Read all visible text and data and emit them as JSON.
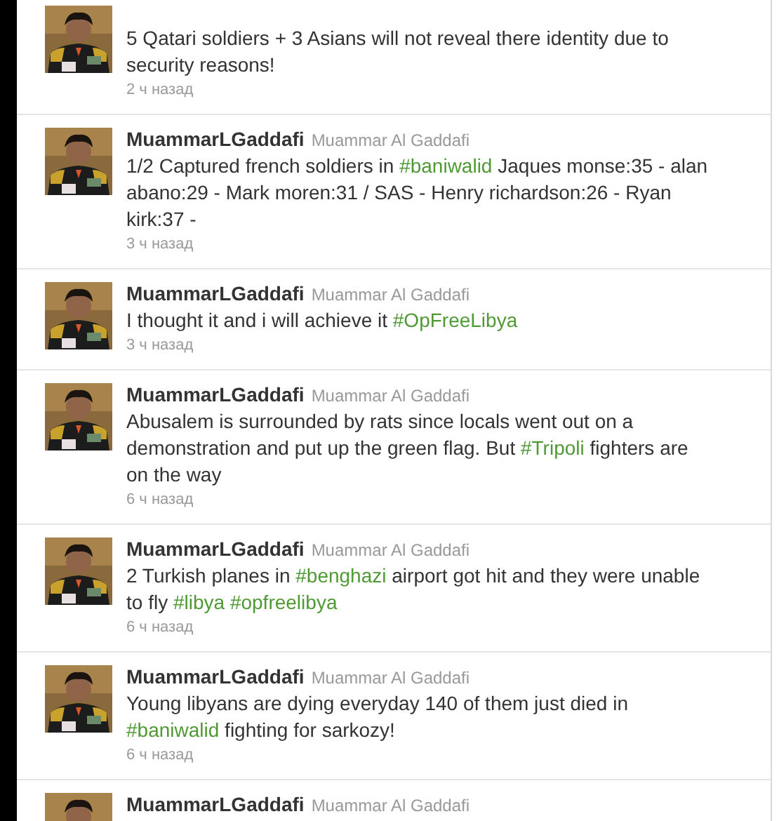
{
  "tweets": [
    {
      "text": [
        {
          "kind": "plain",
          "text": "5 Qatari soldiers + 3 Asians will not reveal there identity due to security reasons!"
        }
      ],
      "time": "2 ч назад"
    },
    {
      "username": "MuammarLGaddafi",
      "fullname": "Muammar Al Gaddafi",
      "text": [
        {
          "kind": "plain",
          "text": "1/2 Captured french soldiers in "
        },
        {
          "kind": "hashtag",
          "text": "#baniwalid"
        },
        {
          "kind": "plain",
          "text": " Jaques monse:35 - alan abano:29 - Mark moren:31 / SAS - Henry richardson:26 - Ryan kirk:37 -"
        }
      ],
      "time": "3 ч назад"
    },
    {
      "username": "MuammarLGaddafi",
      "fullname": "Muammar Al Gaddafi",
      "text": [
        {
          "kind": "plain",
          "text": "I thought it and i will achieve it "
        },
        {
          "kind": "hashtag",
          "text": "#OpFreeLibya"
        }
      ],
      "time": "3 ч назад"
    },
    {
      "username": "MuammarLGaddafi",
      "fullname": "Muammar Al Gaddafi",
      "text": [
        {
          "kind": "plain",
          "text": "Abusalem is surrounded by rats since locals went out on a demonstration and put up the green flag. But "
        },
        {
          "kind": "hashtag",
          "text": "#Tripoli"
        },
        {
          "kind": "plain",
          "text": " fighters are on the way"
        }
      ],
      "time": "6 ч назад"
    },
    {
      "username": "MuammarLGaddafi",
      "fullname": "Muammar Al Gaddafi",
      "text": [
        {
          "kind": "plain",
          "text": "2 Turkish planes in "
        },
        {
          "kind": "hashtag",
          "text": "#benghazi"
        },
        {
          "kind": "plain",
          "text": " airport got hit and they were unable to fly "
        },
        {
          "kind": "hashtag",
          "text": "#libya"
        },
        {
          "kind": "hashtag",
          "text": "#opfreelibya"
        }
      ],
      "time": "6 ч назад"
    },
    {
      "username": "MuammarLGaddafi",
      "fullname": "Muammar Al Gaddafi",
      "text": [
        {
          "kind": "plain",
          "text": "Young libyans are dying everyday 140 of them just died in "
        },
        {
          "kind": "hashtag",
          "text": "#baniwalid"
        },
        {
          "kind": "plain",
          "text": " fighting for sarkozy!"
        }
      ],
      "time": "6 ч назад"
    },
    {
      "username": "MuammarLGaddafi",
      "fullname": "Muammar Al Gaddafi"
    }
  ]
}
